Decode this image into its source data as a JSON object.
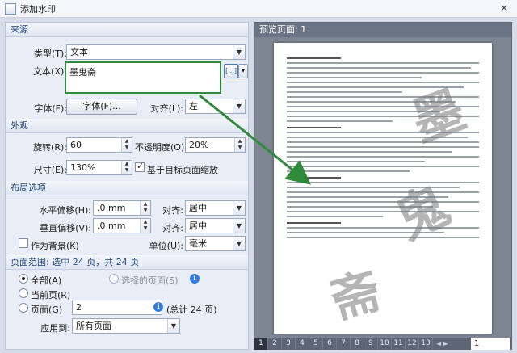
{
  "window": {
    "title": "添加水印",
    "close": "✕"
  },
  "source": {
    "header": "来源",
    "type_label": "类型(T):",
    "type_value": "文本",
    "text_label": "文本(X):",
    "text_value": "墨鬼斋",
    "insert_btn": "[...]",
    "font_label": "字体(F):",
    "font_button": "字体(F)...",
    "align_label": "对齐(L):",
    "align_value": "左"
  },
  "appearance": {
    "header": "外观",
    "rotation_label": "旋转(R):",
    "rotation_value": "60",
    "opacity_label": "不透明度(O):",
    "opacity_value": "20%",
    "size_label": "尺寸(E):",
    "size_value": "130%",
    "scale_checkbox_label": "基于目标页面缩放",
    "scale_checked": true
  },
  "layout": {
    "header": "布局选项",
    "h_offset_label": "水平偏移(H):",
    "h_offset_value": ".0 mm",
    "h_align_label": "对齐:",
    "h_align_value": "居中",
    "v_offset_label": "垂直偏移(V):",
    "v_offset_value": ".0 mm",
    "v_align_label": "对齐:",
    "v_align_value": "居中",
    "background_label": "作为背景(K)",
    "background_checked": false,
    "unit_label": "单位(U):",
    "unit_value": "毫米"
  },
  "page_range": {
    "header": "页面范围: 选中 24 页，共 24 页",
    "all_label": "全部(A)",
    "selected_label": "选择的页面(S)",
    "current_label": "当前页(R)",
    "pages_label": "页面(G)",
    "pages_value": "2",
    "total_text": "(总计 24 页)",
    "apply_label": "应用到:",
    "apply_value": "所有页面",
    "selected_option": "all"
  },
  "preview": {
    "header": "预览页面: 1",
    "watermark_text": "墨鬼斋",
    "pages": [
      "1",
      "2",
      "3",
      "4",
      "5",
      "6",
      "7",
      "8",
      "9",
      "10",
      "11",
      "12",
      "13"
    ],
    "current_page": "1",
    "nav": "◄ ►"
  },
  "colors": {
    "highlight_border": "#2f8a3a",
    "arrow": "#2f8a3a",
    "info_icon": "#2f7de1"
  }
}
